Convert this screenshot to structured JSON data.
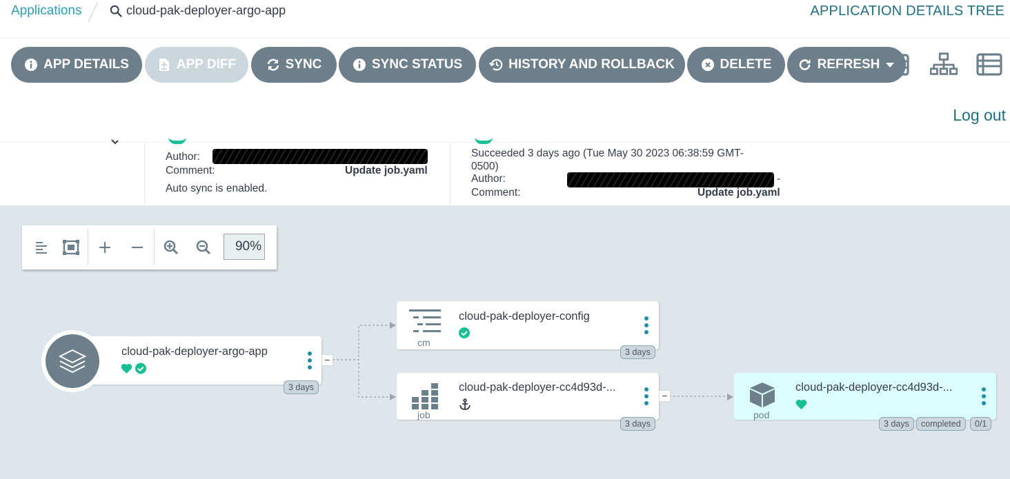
{
  "breadcrumb": {
    "applications": "Applications",
    "app_name": "cloud-pak-deployer-argo-app"
  },
  "view_title": "APPLICATION DETAILS TREE",
  "toolbar": {
    "app_details": "APP DETAILS",
    "app_diff": "APP DIFF",
    "sync": "SYNC",
    "sync_status": "SYNC STATUS",
    "history": "HISTORY AND ROLLBACK",
    "delete": "DELETE",
    "refresh": "REFRESH"
  },
  "logout": "Log out",
  "status": {
    "sync": {
      "author_label": "Author:",
      "comment_label": "Comment:",
      "comment": "Update job.yaml",
      "auto_sync": "Auto sync is enabled."
    },
    "operation": {
      "succeeded": "Succeeded 3 days ago (Tue May 30 2023 06:38:59 GMT-",
      "succeeded_tz": "0500)",
      "author_label": "Author:",
      "author_suffix": "-",
      "comment_label": "Comment:",
      "comment": "Update job.yaml"
    }
  },
  "zoom": {
    "value": "90%"
  },
  "nodes": {
    "app": {
      "name": "cloud-pak-deployer-argo-app",
      "age": "3 days"
    },
    "config": {
      "name": "cloud-pak-deployer-config",
      "kind": "cm",
      "age": "3 days"
    },
    "job": {
      "name": "cloud-pak-deployer-cc4d93d-...",
      "kind": "job",
      "age": "3 days"
    },
    "pod": {
      "name": "cloud-pak-deployer-cc4d93d-...",
      "kind": "pod",
      "age": "3 days",
      "state": "completed",
      "ready": "0/1"
    }
  },
  "colors": {
    "accent": "#1f8ea3",
    "healthy": "#18be94",
    "button": "#6d7f8b",
    "canvas": "#dee6eb",
    "pod_bg": "#dcfdfd"
  },
  "icons": [
    "search-icon",
    "info-icon",
    "file-diff-icon",
    "sync-icon",
    "history-icon",
    "close-circle-icon",
    "refresh-icon",
    "caret-down-icon",
    "tree-view-icon",
    "list-view-icon",
    "heart-icon",
    "check-circle-icon",
    "anchor-icon",
    "layers-icon",
    "configmap-icon",
    "job-icon",
    "pod-icon"
  ]
}
